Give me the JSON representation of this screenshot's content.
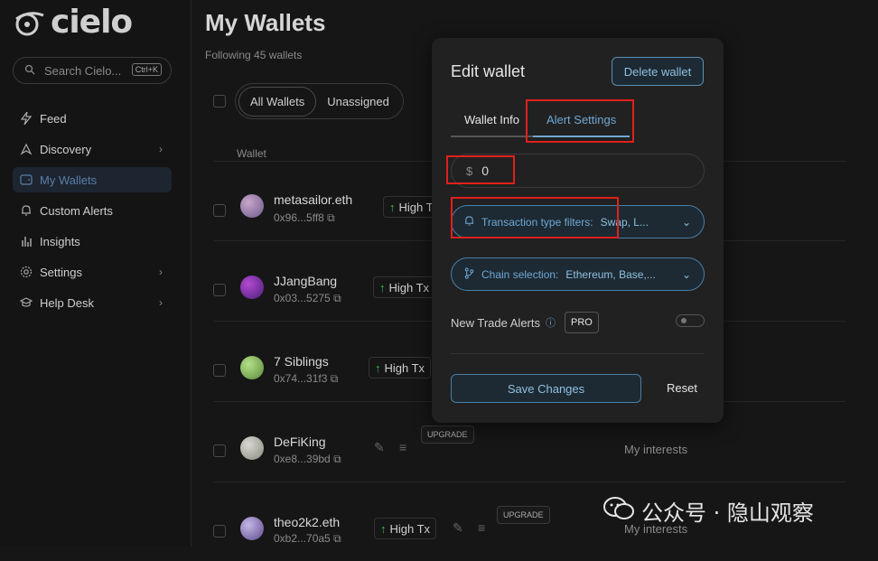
{
  "app": {
    "logo_text": "cielo"
  },
  "search": {
    "placeholder": "Search Cielo...",
    "shortcut": "Ctrl+K"
  },
  "sidebar": {
    "items": [
      {
        "label": "Feed",
        "icon": "lightning-icon"
      },
      {
        "label": "Discovery",
        "icon": "compass-icon",
        "has_chevron": true
      },
      {
        "label": "My Wallets",
        "icon": "wallet-icon",
        "active": true
      },
      {
        "label": "Custom Alerts",
        "icon": "bell-icon"
      },
      {
        "label": "Insights",
        "icon": "bar-chart-icon"
      },
      {
        "label": "Settings",
        "icon": "gear-icon",
        "has_chevron": true
      },
      {
        "label": "Help Desk",
        "icon": "graduation-cap-icon",
        "has_chevron": true
      }
    ]
  },
  "main": {
    "title": "My Wallets",
    "subtitle": "Following 45 wallets",
    "filters": [
      "All Wallets",
      "Unassigned"
    ],
    "column_wallet": "Wallet",
    "wallets": [
      {
        "name": "metasailor.eth",
        "address": "0x96...5ff8",
        "tag": "High Tx"
      },
      {
        "name": "JJangBang",
        "address": "0x03...5275",
        "tag": "High Tx"
      },
      {
        "name": "7 Siblings",
        "address": "0x74...31f3",
        "tag": "High Tx"
      },
      {
        "name": "DeFiKing",
        "address": "0xe8...39bd",
        "upgrade": "UPGRADE",
        "interests": "My interests"
      },
      {
        "name": "theo2k2.eth",
        "address": "0xb2...70a5",
        "tag": "High Tx",
        "upgrade": "UPGRADE",
        "interests": "My interests"
      }
    ]
  },
  "modal": {
    "title": "Edit wallet",
    "delete_label": "Delete wallet",
    "tabs": [
      "Wallet Info",
      "Alert Settings"
    ],
    "amount_currency": "$",
    "amount_value": "0",
    "tx_filter_label": "Transaction type filters:",
    "tx_filter_value": "Swap, L...",
    "chain_label": "Chain selection:",
    "chain_value": "Ethereum, Base,...",
    "new_trade_alerts": "New Trade Alerts",
    "pro_badge": "PRO",
    "save_label": "Save Changes",
    "reset_label": "Reset"
  },
  "watermark": {
    "text": "公众号 · 隐山观察"
  },
  "colors": {
    "accent": "#6fa7d4",
    "highlight": "#e0201b",
    "positive": "#3fb950"
  }
}
